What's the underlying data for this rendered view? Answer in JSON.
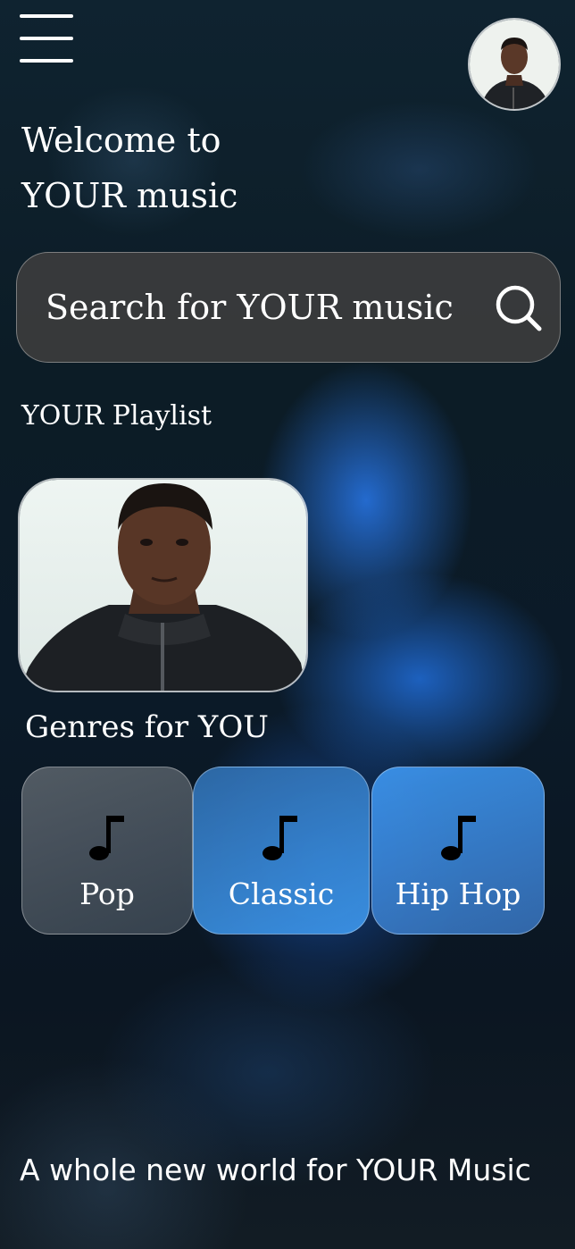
{
  "header": {
    "welcome_line1": "Welcome to",
    "welcome_line2": "YOUR music"
  },
  "search": {
    "placeholder": "Search for YOUR music",
    "icon": "search-icon"
  },
  "playlist": {
    "title": "YOUR Playlist"
  },
  "genres": {
    "title": "Genres for YOU",
    "items": [
      {
        "label": "Pop",
        "icon": "music-note-icon"
      },
      {
        "label": "Classic",
        "icon": "music-note-icon"
      },
      {
        "label": "Hip Hop",
        "icon": "music-note-icon"
      }
    ]
  },
  "footer": {
    "tagline": "A whole new world for YOUR Music"
  }
}
